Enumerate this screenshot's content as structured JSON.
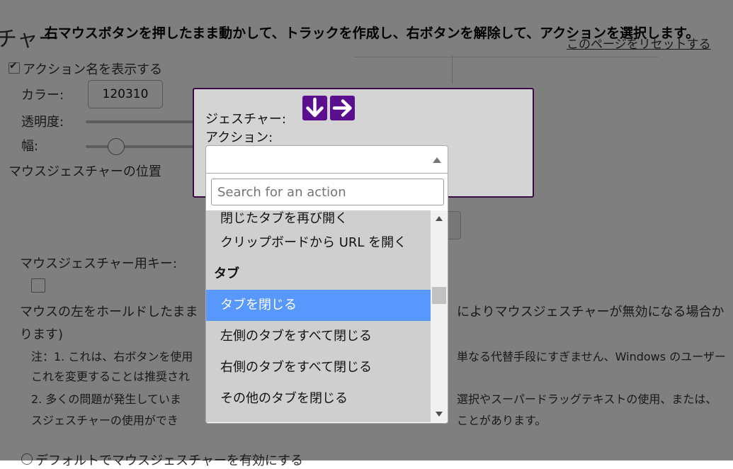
{
  "background": {
    "heading": "チャー",
    "reset_link": "このページをリセットする",
    "show_action_name": "アクション名を表示する",
    "color_label": "カラー:",
    "color_value": "120310",
    "opacity_label": "透明度:",
    "width_label": "幅:",
    "position_label": "マウスジェスチャーの位置",
    "key_label": "マウスジェスチャー用キー:",
    "hold_text_left": "マウスの左をホールドしたまま",
    "hold_text_right": "によりマウスジェスチャーが無効になる場合か",
    "hold_text_line2": "ります)",
    "note1_left": "注：1. これは、右ボタンを使用",
    "note1_right": "単なる代替手段にすぎません、Windows のユーザー",
    "note1_line2": "これを変更することは推奨され",
    "note2_left": "2. 多くの問題が発生していま",
    "note2_right": "選択やスーパードラッグテキストの使用、または、",
    "note2_line2_left": "スジェスチャーの使用ができ",
    "note2_line2_right": "ことがあります。",
    "default_enable": "デフォルトでマウスジェスチャーを有効にする"
  },
  "instruction": "右マウスボタンを押したまま動かして、トラックを作成し、右ボタンを解除して、アクションを選択します。",
  "gesture_dialog": {
    "gesture_label": "ジェスチャー:",
    "action_label": "アクション:",
    "gesture_icons": [
      "arrow-down-icon",
      "arrow-right-icon"
    ],
    "icon_color": "#5b0f8f"
  },
  "action_select": {
    "selected_value": "",
    "search_placeholder": "Search for an action",
    "options": [
      {
        "label": "閉じたタブを再び開く",
        "type": "option"
      },
      {
        "label": "クリップボードから URL を開く",
        "type": "option"
      },
      {
        "label": "タブ",
        "type": "group"
      },
      {
        "label": "タブを閉じる",
        "type": "option",
        "selected": true
      },
      {
        "label": "左側のタブをすべて閉じる",
        "type": "option"
      },
      {
        "label": "右側のタブをすべて閉じる",
        "type": "option"
      },
      {
        "label": "その他のタブを閉じる",
        "type": "option"
      }
    ],
    "highlight_color": "#5897fb"
  }
}
